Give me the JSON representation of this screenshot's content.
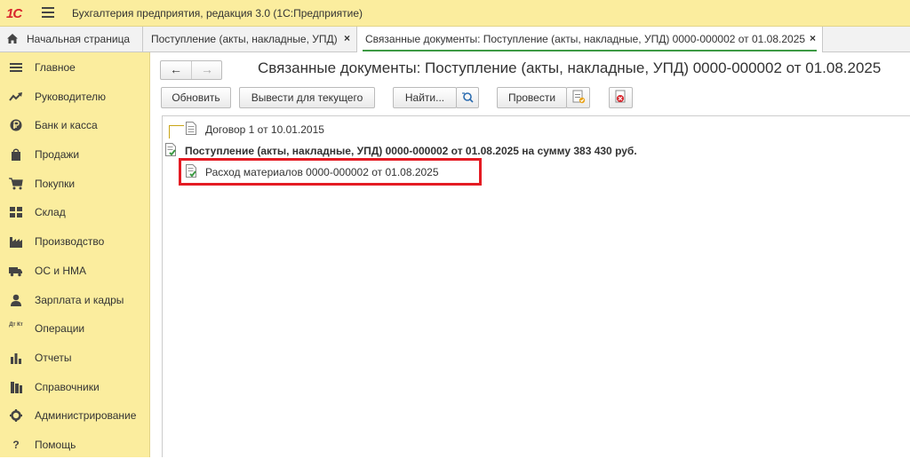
{
  "app": {
    "logo": "1С",
    "title": "Бухгалтерия предприятия, редакция 3.0  (1С:Предприятие)"
  },
  "tabs": [
    {
      "label": "Начальная страница"
    },
    {
      "label": "Поступление (акты, накладные, УПД)",
      "close": "×"
    },
    {
      "label": "Связанные документы: Поступление (акты, накладные, УПД) 0000-000002 от 01.08.2025",
      "close": "×"
    }
  ],
  "sidebar": {
    "items": [
      {
        "label": "Главное",
        "icon": "menu-icon"
      },
      {
        "label": "Руководителю",
        "icon": "trend-icon"
      },
      {
        "label": "Банк и касса",
        "icon": "ruble-icon"
      },
      {
        "label": "Продажи",
        "icon": "bag-icon"
      },
      {
        "label": "Покупки",
        "icon": "cart-icon"
      },
      {
        "label": "Склад",
        "icon": "grid-icon"
      },
      {
        "label": "Производство",
        "icon": "factory-icon"
      },
      {
        "label": "ОС и НМА",
        "icon": "truck-icon"
      },
      {
        "label": "Зарплата и кадры",
        "icon": "person-icon"
      },
      {
        "label": "Операции",
        "icon": "dt-kt-icon"
      },
      {
        "label": "Отчеты",
        "icon": "bar-chart-icon"
      },
      {
        "label": "Справочники",
        "icon": "books-icon"
      },
      {
        "label": "Администрирование",
        "icon": "gear-icon"
      },
      {
        "label": "Помощь",
        "icon": "question-icon"
      }
    ],
    "dt_kt_glyph": "Дт Кт",
    "question_glyph": "?"
  },
  "nav": {
    "back": "←",
    "forward": "→"
  },
  "page": {
    "title": "Связанные документы: Поступление (акты, накладные, УПД) 0000-000002 от 01.08.2025"
  },
  "toolbar": {
    "refresh": "Обновить",
    "show_current": "Вывести для текущего",
    "find": "Найти...",
    "post": "Провести"
  },
  "tree": {
    "contract": "Договор 1 от 10.01.2015",
    "receipt": "Поступление (акты, накладные, УПД) 0000-000002 от 01.08.2025 на сумму 383 430 руб.",
    "expense": "Расход материалов 0000-000002 от 01.08.2025"
  },
  "colors": {
    "panel": "#fbed9e",
    "accent_green": "#3d9a44",
    "highlight_red": "#e41b23",
    "logo_red": "#d8262d"
  }
}
